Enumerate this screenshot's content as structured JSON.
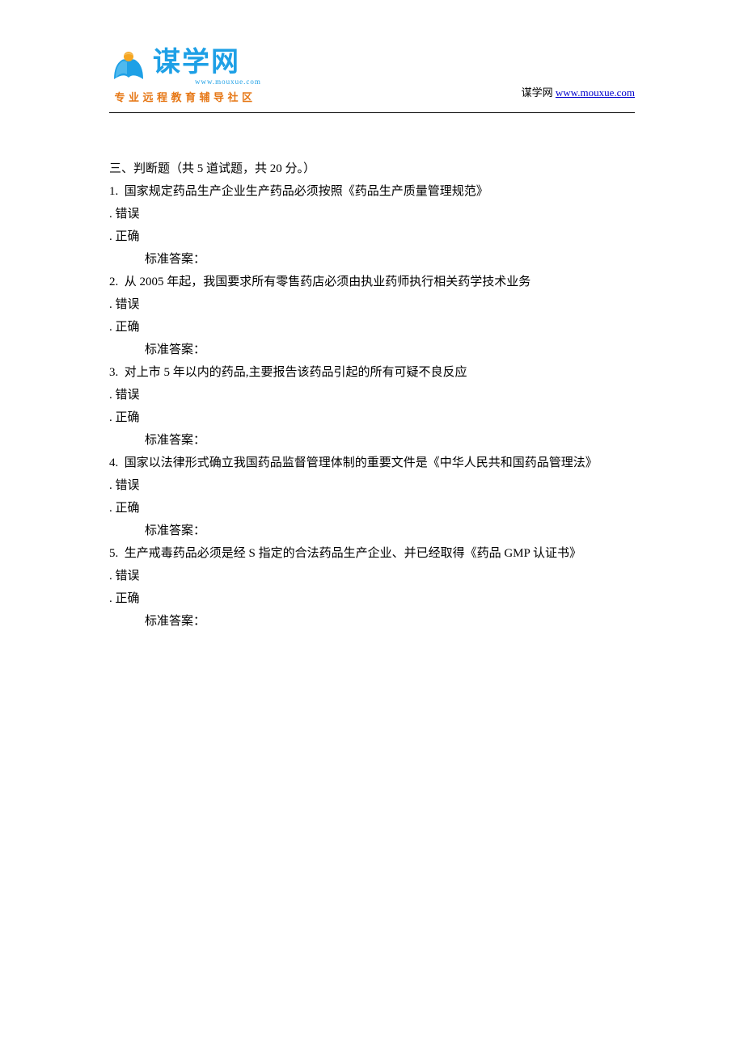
{
  "header": {
    "logo_text": "谋学网",
    "logo_url_small": "www.mouxue.com",
    "logo_tagline": "专业远程教育辅导社区",
    "site_label": "谋学网",
    "site_url_text": "www.mouxue.com",
    "site_url_href": "http://www.mouxue.com"
  },
  "section": {
    "title": "三、判断题（共 5 道试题，共 20 分。）",
    "answer_label": "标准答案：",
    "option_wrong": ". 错误",
    "option_right": ". 正确"
  },
  "questions": [
    {
      "num": "1.",
      "text": "国家规定药品生产企业生产药品必须按照《药品生产质量管理规范》"
    },
    {
      "num": "2.",
      "text": "从 2005 年起，我国要求所有零售药店必须由执业药师执行相关药学技术业务"
    },
    {
      "num": "3.",
      "text": "对上市 5 年以内的药品,主要报告该药品引起的所有可疑不良反应"
    },
    {
      "num": "4.",
      "text": "国家以法律形式确立我国药品监督管理体制的重要文件是《中华人民共和国药品管理法》"
    },
    {
      "num": "5.",
      "text": "生产戒毒药品必须是经 S 指定的合法药品生产企业、并已经取得《药品 GMP 认证书》"
    }
  ]
}
